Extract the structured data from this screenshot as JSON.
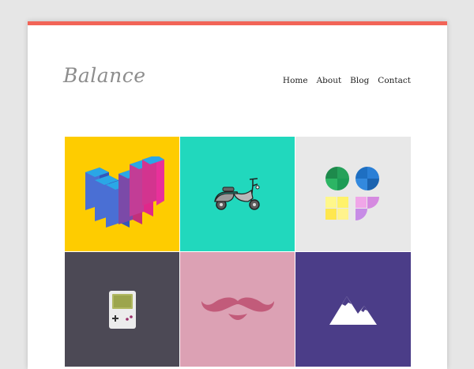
{
  "site": {
    "logo": "Balance",
    "accent_color": "#f26457"
  },
  "nav": {
    "items": [
      "Home",
      "About",
      "Blog",
      "Contact"
    ]
  },
  "portfolio": {
    "tiles": [
      {
        "bg": "#fecc00",
        "icon": "isometric-bars-icon"
      },
      {
        "bg": "#21d8bd",
        "icon": "scooter-icon"
      },
      {
        "bg": "#e8e8e8",
        "icon": "color-shapes-icon"
      },
      {
        "bg": "#4c4955",
        "icon": "gameboy-icon"
      },
      {
        "bg": "#dca1b4",
        "icon": "mustache-icon"
      },
      {
        "bg": "#4b3d88",
        "icon": "mountain-icon"
      }
    ]
  }
}
